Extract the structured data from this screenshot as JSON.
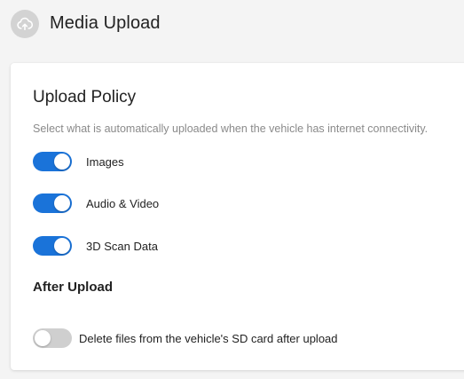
{
  "header": {
    "icon": "cloud-upload-icon",
    "title": "Media Upload"
  },
  "upload_policy": {
    "title": "Upload Policy",
    "description": "Select what is automatically uploaded when the vehicle has internet connectivity.",
    "toggles": [
      {
        "label": "Images",
        "enabled": true
      },
      {
        "label": "Audio & Video",
        "enabled": true
      },
      {
        "label": "3D Scan Data",
        "enabled": true
      }
    ]
  },
  "after_upload": {
    "title": "After Upload",
    "toggle": {
      "label": "Delete files from the vehicle's SD card after upload",
      "enabled": false
    }
  },
  "colors": {
    "toggle_on": "#1a73d9",
    "toggle_off": "#cfcfcf"
  }
}
